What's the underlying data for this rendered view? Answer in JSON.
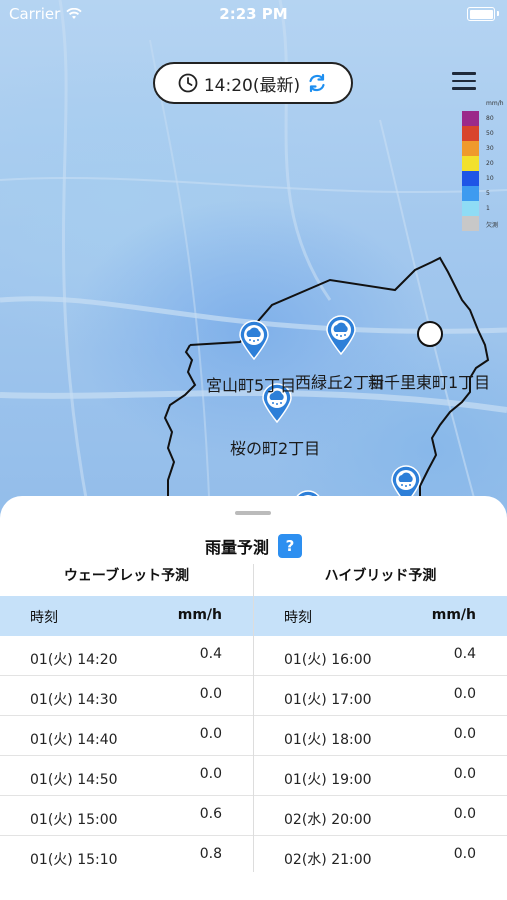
{
  "status_bar": {
    "carrier": "Carrier",
    "time": "2:23 PM"
  },
  "time_pill": {
    "label": "14:20(最新)"
  },
  "legend": {
    "unit": "mm/h",
    "items": [
      {
        "label": "80",
        "color": "#9b2a8a"
      },
      {
        "label": "50",
        "color": "#d8442c"
      },
      {
        "label": "30",
        "color": "#ef9a2c"
      },
      {
        "label": "20",
        "color": "#f2e12c"
      },
      {
        "label": "10",
        "color": "#1f55e6"
      },
      {
        "label": "5",
        "color": "#3e9bf0"
      },
      {
        "label": "1",
        "color": "#8fdcf5"
      },
      {
        "label": "欠測",
        "color": "#c8c8c8"
      }
    ]
  },
  "map_labels": {
    "place_1": "宮山町5丁目",
    "place_2": "西緑丘2丁目",
    "place_3": "新千里東町1丁目",
    "place_4": "桜の町2丁目"
  },
  "sheet": {
    "title": "雨量予測",
    "help_label": "?",
    "left": {
      "heading": "ウェーブレット予測",
      "col_time": "時刻",
      "col_value": "mm/h",
      "rows": [
        {
          "time": "01(火) 14:20",
          "value": "0.4"
        },
        {
          "time": "01(火) 14:30",
          "value": "0.0"
        },
        {
          "time": "01(火) 14:40",
          "value": "0.0"
        },
        {
          "time": "01(火) 14:50",
          "value": "0.0"
        },
        {
          "time": "01(火) 15:00",
          "value": "0.6"
        },
        {
          "time": "01(火) 15:10",
          "value": "0.8"
        }
      ]
    },
    "right": {
      "heading": "ハイブリッド予測",
      "col_time": "時刻",
      "col_value": "mm/h",
      "rows": [
        {
          "time": "01(火) 16:00",
          "value": "0.4"
        },
        {
          "time": "01(火) 17:00",
          "value": "0.0"
        },
        {
          "time": "01(火) 18:00",
          "value": "0.0"
        },
        {
          "time": "01(火) 19:00",
          "value": "0.0"
        },
        {
          "time": "02(水) 20:00",
          "value": "0.0"
        },
        {
          "time": "02(水) 21:00",
          "value": "0.0"
        }
      ]
    }
  }
}
